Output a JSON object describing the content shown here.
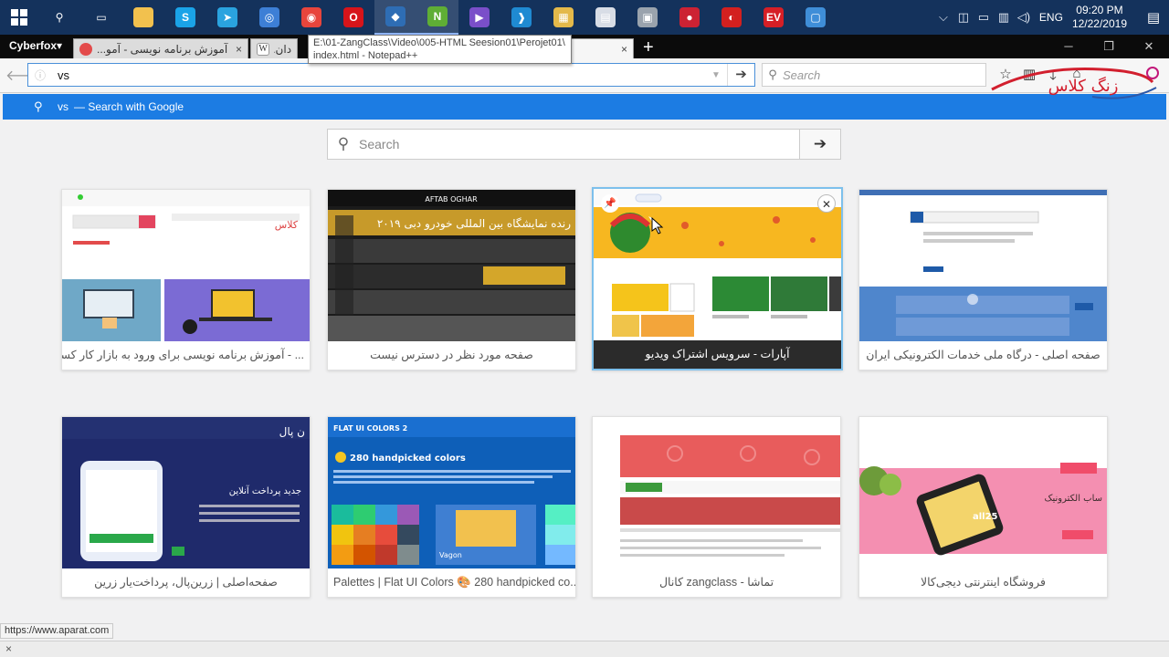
{
  "taskbar": {
    "apps": [
      {
        "name": "search-icon",
        "glyph": "⚲",
        "color": "#14325c"
      },
      {
        "name": "task-view-icon",
        "glyph": "▭",
        "color": "#14325c"
      },
      {
        "name": "file-explorer-icon",
        "glyph": "",
        "color": "#f2c14e"
      },
      {
        "name": "skype-icon",
        "glyph": "S",
        "color": "#1aa3e8"
      },
      {
        "name": "telegram-icon",
        "glyph": "➤",
        "color": "#2aa3df"
      },
      {
        "name": "app-globe-icon",
        "glyph": "◎",
        "color": "#3d7fd6"
      },
      {
        "name": "chrome-icon",
        "glyph": "◉",
        "color": "#e8453c"
      },
      {
        "name": "opera-icon",
        "glyph": "O",
        "color": "#d7141a"
      },
      {
        "name": "cyberfox-icon",
        "glyph": "◆",
        "color": "#2e6db4"
      },
      {
        "name": "notepad-plus-icon",
        "glyph": "N",
        "color": "#5fae35"
      },
      {
        "name": "visual-studio-icon",
        "glyph": "▶",
        "color": "#7a4fc9"
      },
      {
        "name": "vscode-icon",
        "glyph": "❱",
        "color": "#1f8ad2"
      },
      {
        "name": "folder-tools-icon",
        "glyph": "▦",
        "color": "#e4b94a"
      },
      {
        "name": "chart-app-icon",
        "glyph": "▤",
        "color": "#d8dde6"
      },
      {
        "name": "disk-app-icon",
        "glyph": "▣",
        "color": "#9aa3ad"
      },
      {
        "name": "screen-recorder-icon",
        "glyph": "●",
        "color": "#c23"
      },
      {
        "name": "red-app-icon",
        "glyph": "◐",
        "color": "#d3201f"
      },
      {
        "name": "ev-app-icon",
        "glyph": "EV",
        "color": "#d61f26"
      },
      {
        "name": "blue-window-icon",
        "glyph": "▢",
        "color": "#3f8ed8"
      }
    ],
    "tray": {
      "language": "ENG",
      "time": "09:20 PM",
      "date": "12/22/2019"
    }
  },
  "browser": {
    "menu_label": "Cyberfox",
    "tabs": [
      {
        "title": "آموزش برنامه نویسی - آمو...",
        "fav_color": "#e34b4b"
      },
      {
        "title": "دان...",
        "fav_color": "#ffffff"
      }
    ],
    "tooltip": {
      "line1": "E:\\01-ZangClass\\Video\\005-HTML Seesion01\\Perojet01\\",
      "line2": "index.html - Notepad++"
    },
    "url_value": "vs",
    "search_placeholder": "Search",
    "popup": {
      "query": "vs",
      "label": "— Search with Google"
    },
    "brand_text": "زنگ کلاس"
  },
  "newtab": {
    "search_placeholder": "Search",
    "tiles": [
      {
        "title": "... - آموزش برنامه نویسی برای ورود به بازار کار کسب",
        "dir": "rtl"
      },
      {
        "title": "صفحه مورد نظر در دسترس نیست",
        "dir": "rtl"
      },
      {
        "title": "آپارات - سرویس اشتراک ویدیو",
        "dir": "rtl",
        "hover": true
      },
      {
        "title": "صفحه اصلی - درگاه ملی خدمات الکترونیکی ایران",
        "dir": "rtl"
      },
      {
        "title": "صفحه‌اصلی | زرین‌پال، پرداخت‌یار زرین",
        "dir": "rtl"
      },
      {
        "title": "Palettes | Flat UI Colors 🎨 280 handpicked co...",
        "dir": "ltr"
      },
      {
        "title": "تماشا - zangclass کانال",
        "dir": "rtl"
      },
      {
        "title": "فروشگاه اینترنتی دیجی‌کالا",
        "dir": "rtl"
      }
    ],
    "thumb_text": {
      "aftab_banner": "رنده نمایشگاه بین المللی خودرو دبی ۲۰۱۹",
      "aftab_logo": "AFTAB OGHAR",
      "zarinpal_head": "جدید پرداخت آنلاین",
      "zarinpal_logo": "ن پال",
      "flat_head": "FLAT UI COLORS 2",
      "flat_sub": "280 handpicked colors",
      "flat_vagon": "Vagon",
      "digikala_badge": "all25",
      "digikala_text": "ساب الکترونیک",
      "zang_logo": "کلاس"
    }
  },
  "status_url": "https://www.aparat.com",
  "findbar_close": "×"
}
